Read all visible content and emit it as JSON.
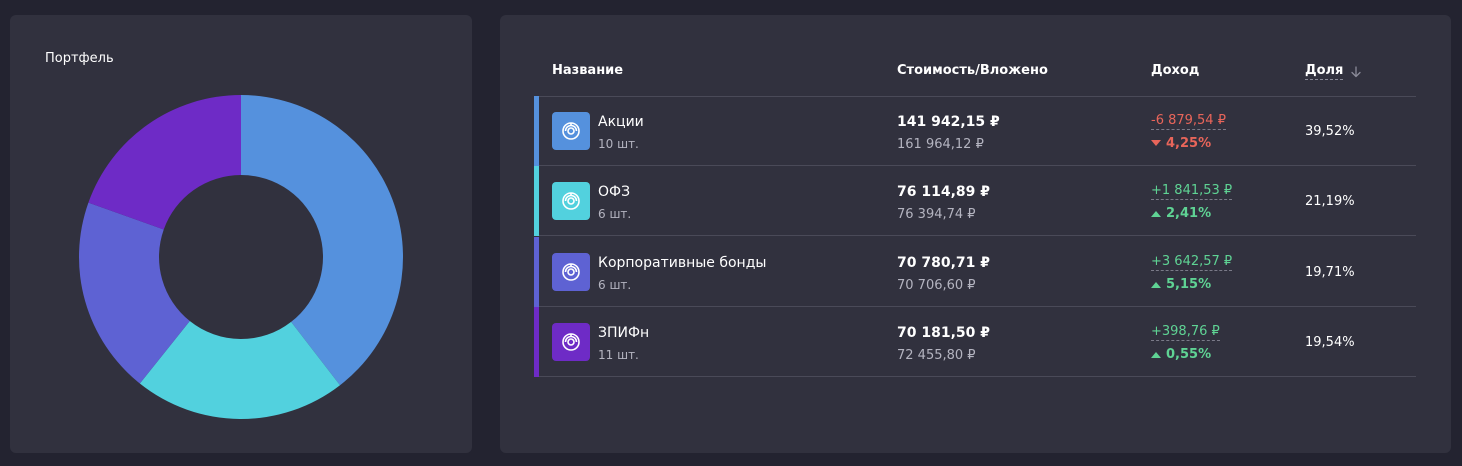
{
  "portfolio": {
    "title": "Портфель",
    "chart_data": {
      "type": "pie",
      "categories": [
        "Акции",
        "ОФЗ",
        "Корпоративные бонды",
        "ЗПИФн"
      ],
      "values": [
        39.52,
        21.19,
        19.71,
        19.54
      ],
      "colors": [
        "#5591dd",
        "#52d1de",
        "#5e62d3",
        "#6e2bc6"
      ],
      "donut": true
    }
  },
  "table": {
    "headers": {
      "name": "Название",
      "value": "Стоимость/Вложено",
      "income": "Доход",
      "share": "Доля"
    },
    "sort_icon": "arrow-down-icon",
    "rows": [
      {
        "name": "Акции",
        "qty": "10 шт.",
        "cost": "141 942,15 ₽",
        "invested": "161 964,12 ₽",
        "income": "-6 879,54 ₽",
        "pct": "4,25%",
        "direction": "down",
        "share": "39,52%",
        "color": "#5591dd",
        "icon": "asset-icon"
      },
      {
        "name": "ОФЗ",
        "qty": "6 шт.",
        "cost": "76 114,89 ₽",
        "invested": "76 394,74 ₽",
        "income": "+1 841,53 ₽",
        "pct": "2,41%",
        "direction": "up",
        "share": "21,19%",
        "color": "#52d1de",
        "icon": "asset-icon"
      },
      {
        "name": "Корпоративные бонды",
        "qty": "6 шт.",
        "cost": "70 780,71 ₽",
        "invested": "70 706,60 ₽",
        "income": "+3 642,57 ₽",
        "pct": "5,15%",
        "direction": "up",
        "share": "19,71%",
        "color": "#5e62d3",
        "icon": "asset-icon"
      },
      {
        "name": "ЗПИФн",
        "qty": "11 шт.",
        "cost": "70 181,50 ₽",
        "invested": "72 455,80 ₽",
        "income": "+398,76 ₽",
        "pct": "0,55%",
        "direction": "up",
        "share": "19,54%",
        "color": "#6e2bc6",
        "icon": "asset-icon"
      }
    ]
  }
}
